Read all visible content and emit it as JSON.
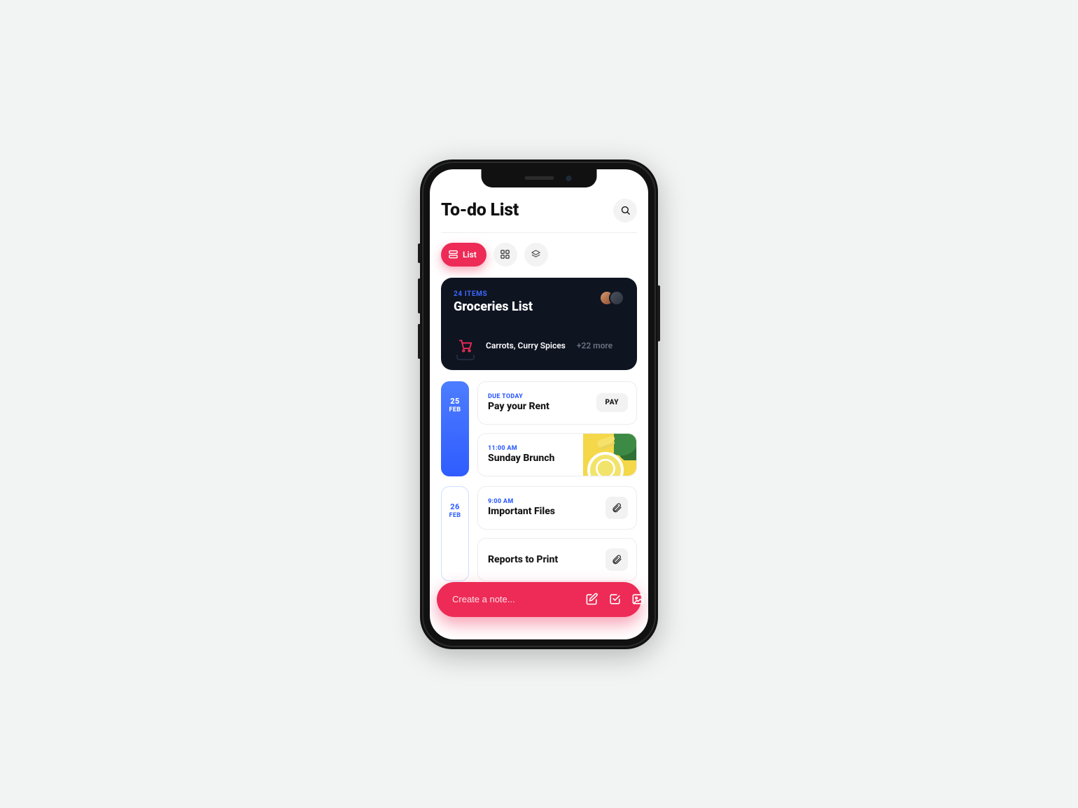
{
  "header": {
    "title": "To-do List"
  },
  "view_tabs": {
    "list_label": "List"
  },
  "featured": {
    "items_badge": "24 ITEMS",
    "title": "Groceries List",
    "preview_items": "Carrots, Curry Spices",
    "more_label": "+22 more"
  },
  "days": [
    {
      "date_day": "25",
      "date_month": "FEB",
      "style": "filled",
      "events": [
        {
          "meta": "DUE TODAY",
          "name": "Pay your Rent",
          "action_label": "PAY",
          "type": "action"
        },
        {
          "meta": "11:00 AM",
          "name": "Sunday Brunch",
          "type": "image"
        }
      ]
    },
    {
      "date_day": "26",
      "date_month": "FEB",
      "style": "outline",
      "events": [
        {
          "meta": "9:00 AM",
          "name": "Important Files",
          "type": "attachment"
        },
        {
          "meta": "",
          "name": "Reports to Print",
          "type": "attachment"
        }
      ]
    }
  ],
  "composer": {
    "placeholder": "Create a note..."
  }
}
